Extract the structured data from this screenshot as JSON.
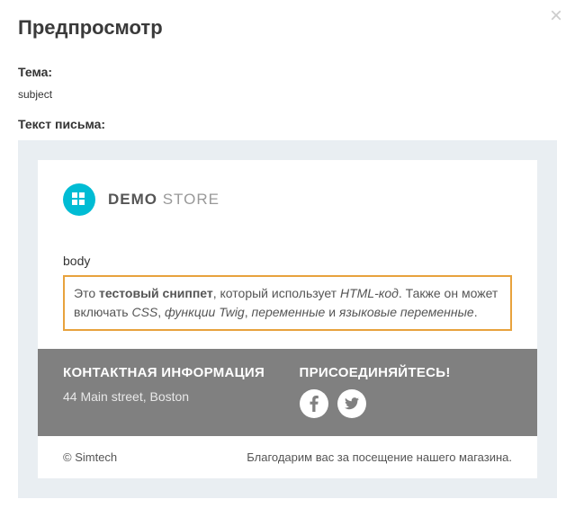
{
  "modal": {
    "title": "Предпросмотр",
    "close": "×"
  },
  "subject": {
    "label": "Тема:",
    "value": "subject"
  },
  "body_section": {
    "label": "Текст письма:"
  },
  "email": {
    "logo": {
      "bold": "DEMO",
      "light": " STORE"
    },
    "body_text": "body",
    "snippet": {
      "prefix": "Это ",
      "bold1": "тестовый сниппет",
      "mid1": ", который использует ",
      "italic1": "HTML-код",
      "mid2": ". Также он может включать ",
      "italic2": "CSS",
      "mid3": ", ",
      "italic3": "функции Twig",
      "mid4": ", ",
      "italic4": "переменные",
      "mid5": " и ",
      "italic5": "языковые переменные",
      "suffix": "."
    },
    "footer": {
      "contact_heading": "КОНТАКТНАЯ ИНФОРМАЦИЯ",
      "contact_address": "44 Main street, Boston",
      "social_heading": "ПРИСОЕДИНЯЙТЕСЬ!"
    },
    "copyright": "© Simtech",
    "thanks": "Благодарим вас за посещение нашего магазина."
  }
}
